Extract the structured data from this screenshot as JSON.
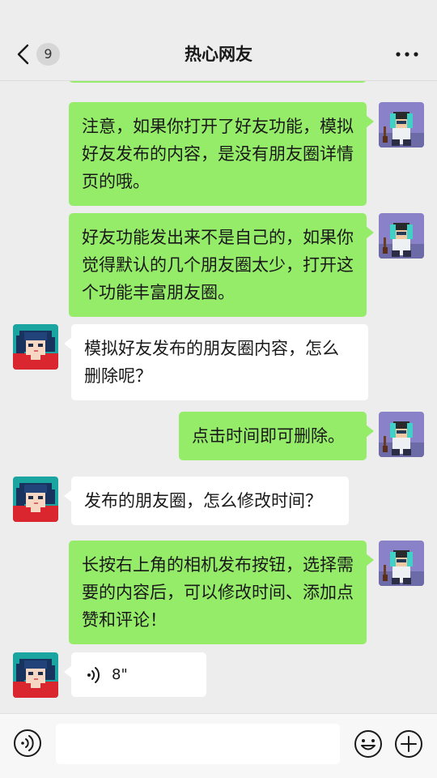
{
  "header": {
    "title": "热心网友",
    "unread_count": "9",
    "back_icon": "chevron-left-icon",
    "more_icon": "more-horizontal-icon"
  },
  "messages": [
    {
      "side": "out",
      "type": "text",
      "text": "注意，如果你打开了好友功能，模拟好友发布的内容，是没有朋友圈详情页的哦。"
    },
    {
      "side": "out",
      "type": "text",
      "text": "好友功能发出来不是自己的，如果你觉得默认的几个朋友圈太少，打开这个功能丰富朋友圈。"
    },
    {
      "side": "in",
      "type": "text",
      "text": "模拟好友发布的朋友圈内容，怎么删除呢？"
    },
    {
      "side": "out",
      "type": "text",
      "text": "点击时间即可删除。"
    },
    {
      "side": "in",
      "type": "text",
      "text": "发布的朋友圈，怎么修改时间？"
    },
    {
      "side": "out",
      "type": "text",
      "text": "长按右上角的相机发布按钮，选择需要的内容后，可以修改时间、添加点赞和评论！"
    },
    {
      "side": "in",
      "type": "voice",
      "duration": "8\""
    }
  ],
  "toolbar": {
    "input_value": "",
    "voice_icon": "voice-mode-icon",
    "emoji_icon": "emoji-icon",
    "plus_icon": "plus-circle-icon"
  },
  "colors": {
    "outgoing_bubble": "#95ec69",
    "incoming_bubble": "#ffffff",
    "background": "#ededed"
  }
}
